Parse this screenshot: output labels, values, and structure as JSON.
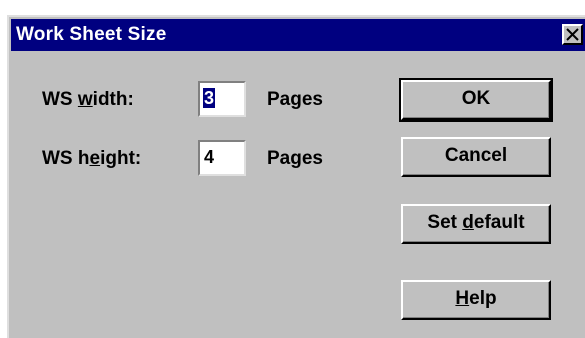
{
  "dialog": {
    "title": "Work Sheet Size",
    "close_glyph": "✕"
  },
  "fields": {
    "width": {
      "label_prefix": "WS ",
      "label_accel": "w",
      "label_suffix": "idth:",
      "value": "3",
      "unit": "Pages"
    },
    "height": {
      "label_prefix": "WS h",
      "label_accel": "e",
      "label_suffix": "ight:",
      "value": "4",
      "unit": "Pages"
    }
  },
  "buttons": {
    "ok": {
      "label": "OK"
    },
    "cancel": {
      "label": "Cancel"
    },
    "set_default": {
      "prefix": "Set ",
      "accel": "d",
      "suffix": "efault"
    },
    "help": {
      "prefix": "",
      "accel": "H",
      "suffix": "elp"
    }
  }
}
